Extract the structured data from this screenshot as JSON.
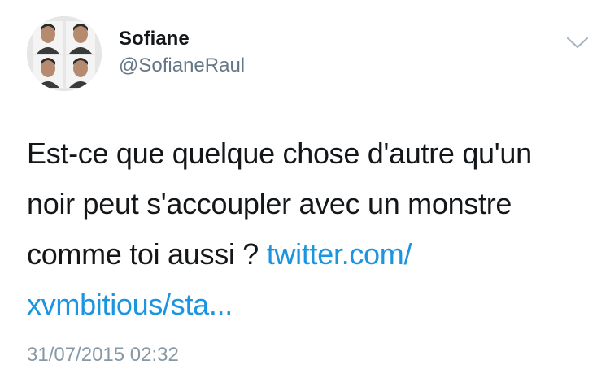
{
  "tweet": {
    "author": {
      "display_name": "Sofiane",
      "handle": "@SofianeRaul",
      "avatar_icon": "profile-photo"
    },
    "menu_icon": "chevron-down-icon",
    "text": {
      "line1": "Est-ce que quelque chose d'autre qu'un",
      "line2": "noir peut s'accoupler avec un monstre",
      "line3_text": "comme toi aussi ?",
      "link_part1": "twitter.com/",
      "link_part2": "xvmbitious/sta..."
    },
    "timestamp": "31/07/2015 02:32"
  },
  "colors": {
    "text": "#14171a",
    "secondary": "#657786",
    "timestamp": "#8899a6",
    "link": "#1b95e0",
    "background": "#ffffff"
  }
}
